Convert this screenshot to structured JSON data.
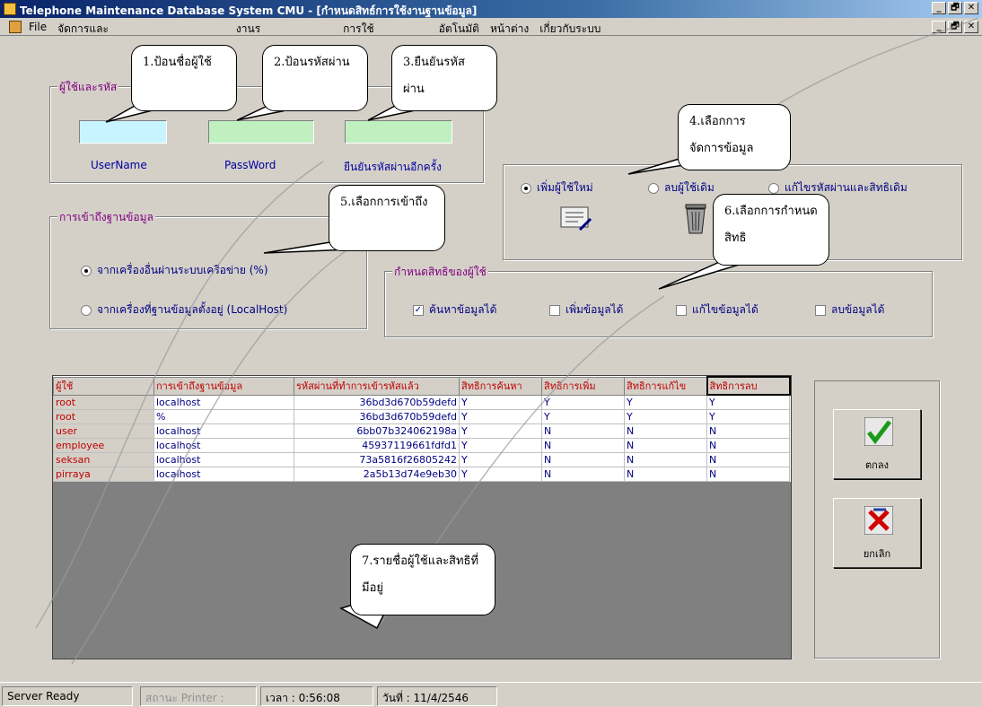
{
  "window": {
    "title": "Telephone Maintenance Database System CMU - [กำหนดสิทธ์การใช้งานฐานข้อมูล]",
    "min": "_",
    "max": "🗗",
    "close": "✕"
  },
  "menu": [
    "File",
    "จัดการและ",
    "งานร",
    "การใช้",
    "อัตโนมัติ",
    "หน้าต่าง",
    "เกี่ยวกับระบบ"
  ],
  "users_group": {
    "label": "ผู้ใช้และรหัส",
    "username_label": "UserName",
    "password_label": "PassWord",
    "confirm_label": "ยืนยันรหัสผ่านอีกครั้ง"
  },
  "manage_group": {
    "options": [
      "เพิ่มผู้ใช้ใหม่",
      "ลบผู้ใช้เดิม",
      "แก้ไขรหัสผ่านและสิทธิเดิม"
    ],
    "selected": 0
  },
  "access_group": {
    "label": "การเข้าถึงฐานข้อมูล",
    "options": [
      "จากเครื่องอื่นผ่านระบบเครือข่าย (%)",
      "จากเครื่องที่ฐานข้อมูลตั้งอยู่ (LocalHost)"
    ],
    "selected": 0
  },
  "rights_group": {
    "label": "กำหนดสิทธิของผู้ใช้",
    "options": [
      {
        "label": "ค้นหาข้อมูลได้",
        "checked": true
      },
      {
        "label": "เพิ่มข้อมูลได้",
        "checked": false
      },
      {
        "label": "แก้ไขข้อมูลได้",
        "checked": false
      },
      {
        "label": "ลบข้อมูลได้",
        "checked": false
      }
    ]
  },
  "grid": {
    "headers": [
      "ผู้ใช้",
      "การเข้าถึงฐานข้อมูล",
      "รหัสผ่านที่ทำการเข้ารหัสแล้ว",
      "สิทธิการค้นหา",
      "สิทธิการเพิ่ม",
      "สิทธิการแก้ไข",
      "สิทธิการลบ"
    ],
    "rows": [
      [
        "root",
        "localhost",
        "36bd3d670b59defd",
        "Y",
        "Y",
        "Y",
        "Y"
      ],
      [
        "root",
        "%",
        "36bd3d670b59defd",
        "Y",
        "Y",
        "Y",
        "Y"
      ],
      [
        "user",
        "localhost",
        "6bb07b324062198a",
        "Y",
        "N",
        "N",
        "N"
      ],
      [
        "employee",
        "localhost",
        "45937119661fdfd1",
        "Y",
        "N",
        "N",
        "N"
      ],
      [
        "seksan",
        "localhost",
        "73a5816f26805242",
        "Y",
        "N",
        "N",
        "N"
      ],
      [
        "pirraya",
        "localhost",
        "2a5b13d74e9eb30",
        "Y",
        "N",
        "N",
        "N"
      ]
    ]
  },
  "buttons": {
    "ok": "ตกลง",
    "cancel": "ยกเลิก"
  },
  "status": {
    "ready": "Server Ready",
    "printer": "สถานะ Printer :",
    "time": "เวลา : 0:56:08",
    "date": "วันที่ : 11/4/2546"
  },
  "callouts": [
    "1.ป้อนชื่อผู้ใช้",
    "2.ป้อนรหัสผ่าน",
    "3.ยืนยันรหัสผ่าน",
    "4.เลือกการจัดการข้อมูล",
    "5.เลือกการเข้าถึง",
    "6.เลือกการกำหนดสิทธิ",
    "7.รายชื่อผู้ใช้และสิทธิที่มีอยู่"
  ]
}
